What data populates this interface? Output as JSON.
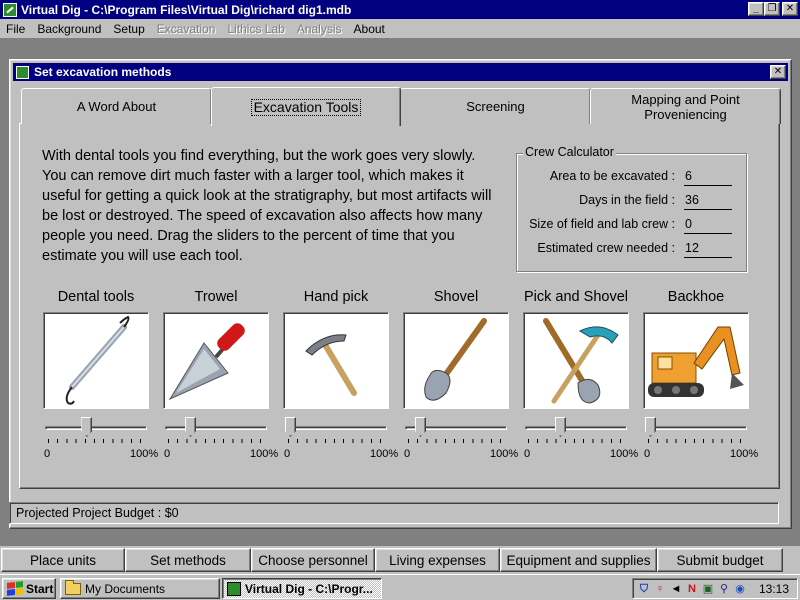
{
  "window": {
    "title": "Virtual Dig - C:\\Program Files\\Virtual Dig\\richard dig1.mdb",
    "minimize_glyph": "_",
    "maximize_glyph": "❐",
    "close_glyph": "✕"
  },
  "menu": {
    "items": [
      {
        "label": "File",
        "enabled": true
      },
      {
        "label": "Background",
        "enabled": true
      },
      {
        "label": "Setup",
        "enabled": true
      },
      {
        "label": "Excavation",
        "enabled": false
      },
      {
        "label": "Lithics Lab",
        "enabled": false
      },
      {
        "label": "Analysis",
        "enabled": false
      },
      {
        "label": "About",
        "enabled": true
      }
    ]
  },
  "dialog": {
    "title": "Set excavation methods",
    "close_glyph": "✕",
    "tabs": [
      {
        "label": "A Word About",
        "active": false
      },
      {
        "label": "Excavation Tools",
        "active": true
      },
      {
        "label": "Screening",
        "active": false
      },
      {
        "label": "Mapping and Point Proveniencing",
        "active": false
      }
    ],
    "intro_text": "With dental tools you find everything, but the work goes very slowly.  You can remove dirt much faster with a larger tool, which makes it useful for getting a quick look at the stratigraphy, but most artifacts will be lost or destroyed.  The speed of excavation also affects how many people you need.  Drag the sliders to the percent of time that you estimate you will use each tool.",
    "crew_calculator": {
      "legend": "Crew Calculator",
      "rows": [
        {
          "label": "Area to be excavated :",
          "value": "6"
        },
        {
          "label": "Days in the field :",
          "value": "36"
        },
        {
          "label": "Size of field and lab crew :",
          "value": "0"
        },
        {
          "label": "Estimated crew needed :",
          "value": "12"
        }
      ]
    },
    "tools": [
      {
        "label": "Dental tools",
        "icon": "dental-tool-icon",
        "slider_percent": 40,
        "min_label": "0",
        "max_label": "100%"
      },
      {
        "label": "Trowel",
        "icon": "trowel-icon",
        "slider_percent": 22,
        "min_label": "0",
        "max_label": "100%"
      },
      {
        "label": "Hand pick",
        "icon": "hand-pick-icon",
        "slider_percent": 0,
        "min_label": "0",
        "max_label": "100%"
      },
      {
        "label": "Shovel",
        "icon": "shovel-icon",
        "slider_percent": 11,
        "min_label": "0",
        "max_label": "100%"
      },
      {
        "label": "Pick and Shovel",
        "icon": "pick-and-shovel-icon",
        "slider_percent": 33,
        "min_label": "0",
        "max_label": "100%"
      },
      {
        "label": "Backhoe",
        "icon": "backhoe-icon",
        "slider_percent": 0,
        "min_label": "0",
        "max_label": "100%"
      }
    ],
    "budget_text": "Projected Project Budget : $0"
  },
  "nav_buttons": [
    {
      "label": "Place units"
    },
    {
      "label": "Set methods"
    },
    {
      "label": "Choose personnel"
    },
    {
      "label": "Living expenses"
    },
    {
      "label": "Equipment and supplies"
    },
    {
      "label": "Submit budget"
    }
  ],
  "taskbar": {
    "start_label": "Start",
    "buttons": [
      {
        "label": "My Documents",
        "icon": "folder-icon",
        "pressed": false
      },
      {
        "label": "Virtual Dig - C:\\Progr...",
        "icon": "virtual-dig-icon",
        "pressed": true
      }
    ],
    "tray_icons": [
      "shield-icon",
      "pin-icon",
      "speaker-icon",
      "n-icon",
      "network-icon",
      "search-icon",
      "eye-icon"
    ],
    "clock": "13:13"
  }
}
